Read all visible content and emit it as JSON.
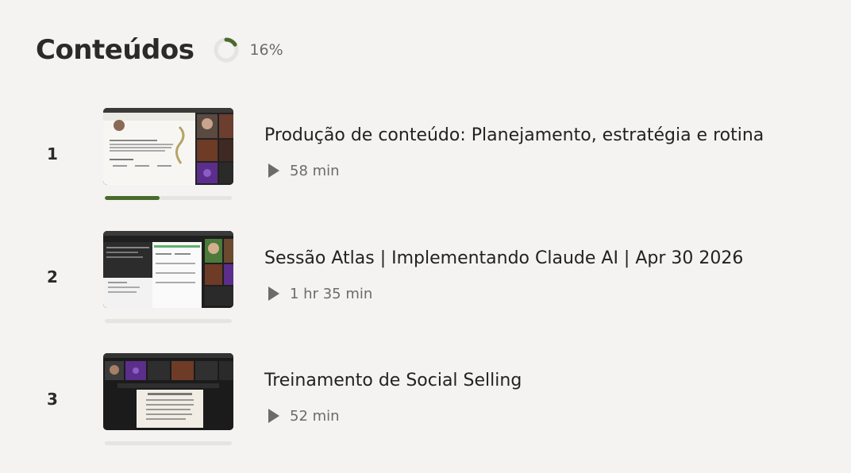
{
  "header": {
    "title": "Conteúdos",
    "progress_label": "16%",
    "progress_value": 0.16
  },
  "colors": {
    "accent": "#4a6a2c",
    "background": "#f4f3f1",
    "track": "#e6e4e0"
  },
  "lessons": [
    {
      "number": "1",
      "title": "Produção de conteúdo: Planejamento, estratégia e rotina",
      "duration": "58 min",
      "progress": 0.43,
      "thumbnail_icon": "video-thumbnail"
    },
    {
      "number": "2",
      "title": "Sessão Atlas | Implementando Claude AI | Apr 30 2026",
      "duration": "1 hr 35 min",
      "progress": 0,
      "thumbnail_icon": "video-thumbnail"
    },
    {
      "number": "3",
      "title": "Treinamento de Social Selling",
      "duration": "52 min",
      "progress": 0,
      "thumbnail_icon": "video-thumbnail"
    }
  ],
  "icons": {
    "play": "play-icon",
    "progress": "progress-ring-icon"
  }
}
